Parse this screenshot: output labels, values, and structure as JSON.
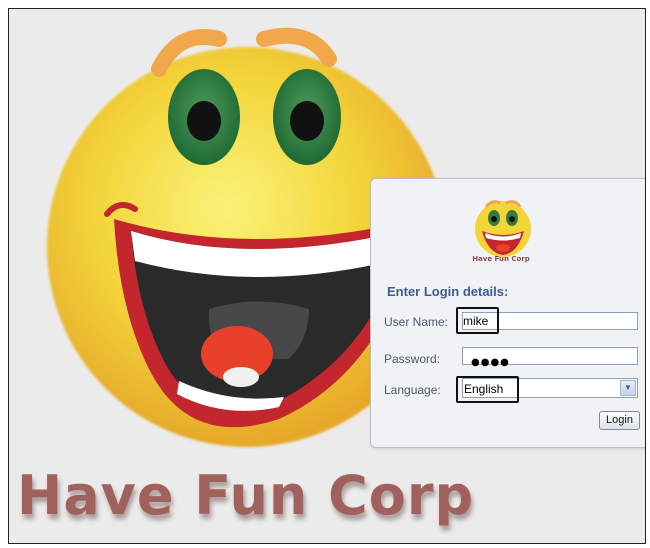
{
  "background": {
    "brand_text": "Have Fun Corp",
    "icon": "smiley-face"
  },
  "login_panel": {
    "logo_text": "Have Fun Corp",
    "heading": "Enter Login details:",
    "username": {
      "label": "User Name:",
      "value": "mike"
    },
    "password": {
      "label": "Password:",
      "masked_value": "●●●●"
    },
    "language": {
      "label": "Language:",
      "selected": "English",
      "arrow_icon": "chevron-down-icon"
    },
    "login_button": "Login"
  },
  "colors": {
    "heading": "#3a5f8e",
    "brand": "#a0605c",
    "panel_bg": "#f1f2f6"
  }
}
